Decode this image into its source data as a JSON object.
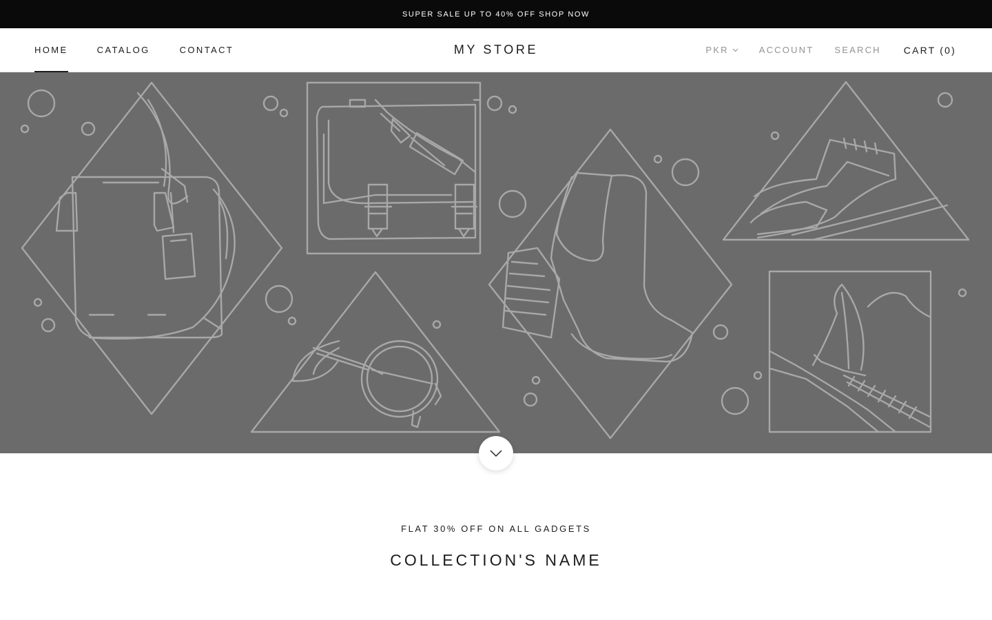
{
  "announcement": {
    "text": "SUPER SALE UP TO 40% OFF SHOP NOW"
  },
  "header": {
    "nav": [
      {
        "label": "HOME",
        "active": true
      },
      {
        "label": "CATALOG",
        "active": false
      },
      {
        "label": "CONTACT",
        "active": false
      }
    ],
    "logo": "MY STORE",
    "currency": "PKR",
    "account_label": "ACCOUNT",
    "search_label": "SEARCH",
    "cart_label": "CART (0)"
  },
  "hero": {
    "background_color": "#6b6b6b",
    "line_color": "#a8a8a8",
    "illustrations": [
      "handbag-icon",
      "briefcase-icon",
      "boot-icon",
      "oxford-shoe-icon",
      "sunglasses-icon",
      "hat-feather-icon"
    ]
  },
  "scroll_button": {
    "icon": "chevron-down-icon"
  },
  "section": {
    "subheading": "FLAT 30% OFF ON ALL GADGETS",
    "heading": "COLLECTION'S NAME"
  }
}
